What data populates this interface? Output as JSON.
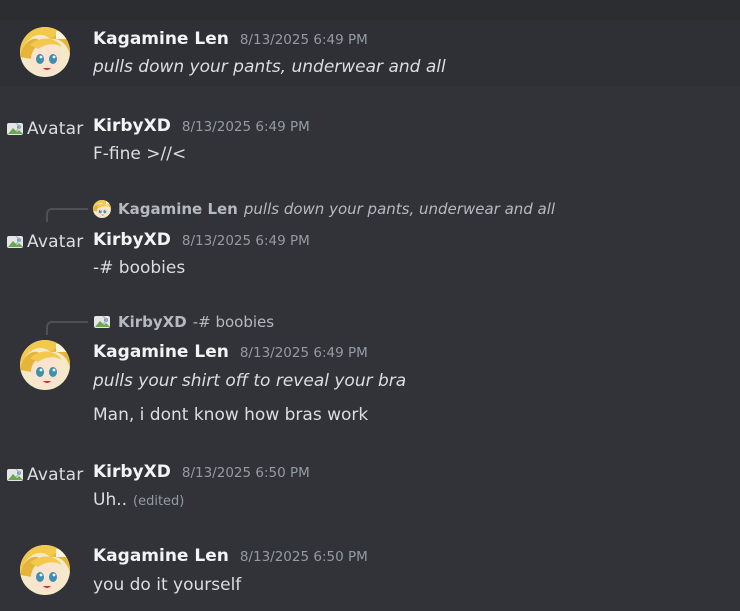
{
  "colors": {
    "background": "#313338",
    "highlight": "#2e3035",
    "username": "#f2f3f5",
    "timestamp": "#949ba4",
    "text": "#dbdee1"
  },
  "messages": [
    {
      "author": "Kagamine Len",
      "avatar": "len-avatar",
      "timestamp": "8/13/2025 6:49 PM",
      "lines": [
        "pulls down your pants, underwear and all"
      ],
      "highlighted": true
    },
    {
      "author": "KirbyXD",
      "avatar_alt": "Avatar",
      "timestamp": "8/13/2025 6:49 PM",
      "lines": [
        "F-fine >//<"
      ]
    },
    {
      "reply": {
        "author": "Kagamine Len",
        "text": "pulls down your pants, underwear and all"
      },
      "author": "KirbyXD",
      "avatar_alt": "Avatar",
      "timestamp": "8/13/2025 6:49 PM",
      "lines": [
        "-# boobies"
      ]
    },
    {
      "reply": {
        "author": "KirbyXD",
        "text": "-# boobies"
      },
      "author": "Kagamine Len",
      "avatar": "len-avatar",
      "timestamp": "8/13/2025 6:49 PM",
      "lines": [
        "pulls your shirt off to reveal your bra",
        "Man, i dont know how bras work"
      ]
    },
    {
      "author": "KirbyXD",
      "avatar_alt": "Avatar",
      "timestamp": "8/13/2025 6:50 PM",
      "lines": [
        "Uh.."
      ],
      "edited_label": "(edited)"
    },
    {
      "author": "Kagamine Len",
      "avatar": "len-avatar",
      "timestamp": "8/13/2025 6:50 PM",
      "lines": [
        "you do it yourself"
      ]
    }
  ]
}
